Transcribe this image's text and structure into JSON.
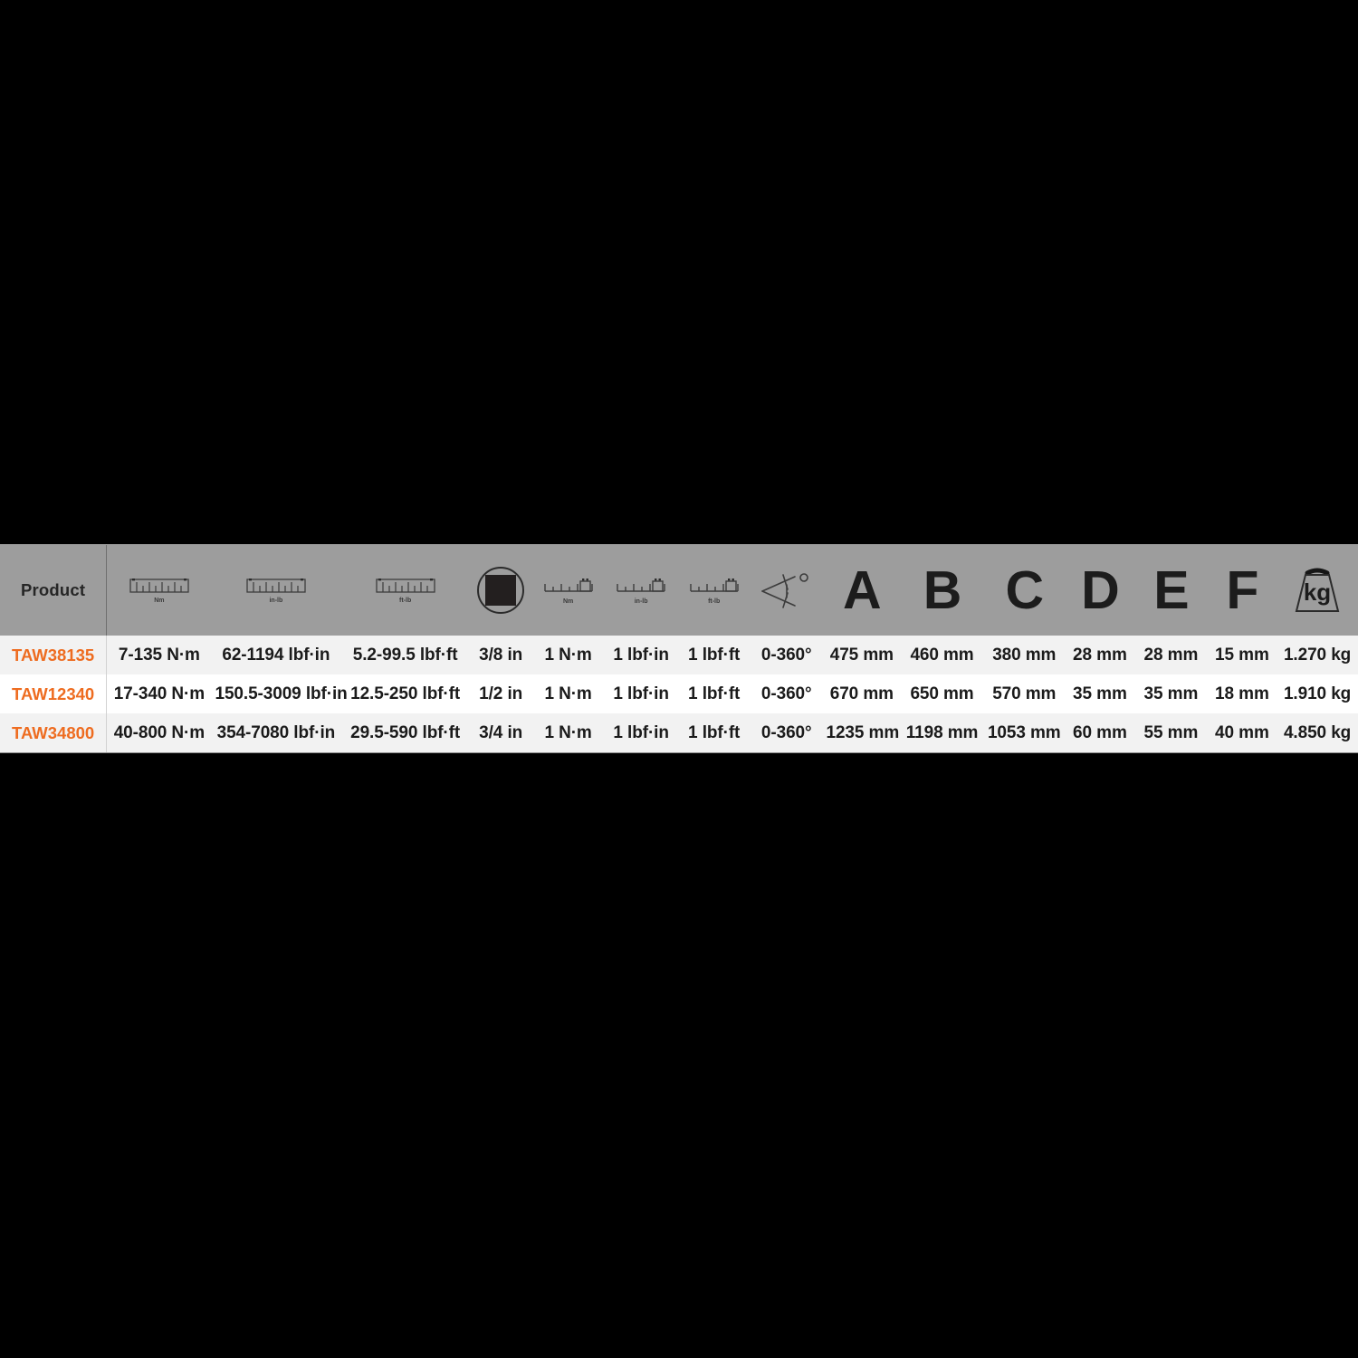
{
  "table": {
    "columns": [
      {
        "key": "product",
        "label": "Product",
        "icon": null,
        "icon_caption": null
      },
      {
        "key": "range_nm",
        "label": "",
        "icon": "ruler-icon",
        "icon_caption": "Nm"
      },
      {
        "key": "range_lbfin",
        "label": "",
        "icon": "ruler-icon",
        "icon_caption": "in-lb"
      },
      {
        "key": "range_lbfft",
        "label": "",
        "icon": "ruler-icon",
        "icon_caption": "ft-lb"
      },
      {
        "key": "drive",
        "label": "",
        "icon": "square-drive-icon",
        "icon_caption": null
      },
      {
        "key": "res_nm",
        "label": "",
        "icon": "graduation-icon",
        "icon_caption": "Nm"
      },
      {
        "key": "res_lbfin",
        "label": "",
        "icon": "graduation-icon",
        "icon_caption": "in-lb"
      },
      {
        "key": "res_lbfft",
        "label": "",
        "icon": "graduation-icon",
        "icon_caption": "ft-lb"
      },
      {
        "key": "angle",
        "label": "",
        "icon": "angle-degree-icon",
        "icon_caption": null
      },
      {
        "key": "dim_a",
        "label": "A",
        "icon": null,
        "icon_caption": null
      },
      {
        "key": "dim_b",
        "label": "B",
        "icon": null,
        "icon_caption": null
      },
      {
        "key": "dim_c",
        "label": "C",
        "icon": null,
        "icon_caption": null
      },
      {
        "key": "dim_d",
        "label": "D",
        "icon": null,
        "icon_caption": null
      },
      {
        "key": "dim_e",
        "label": "E",
        "icon": null,
        "icon_caption": null
      },
      {
        "key": "dim_f",
        "label": "F",
        "icon": null,
        "icon_caption": null
      },
      {
        "key": "weight",
        "label": "",
        "icon": "weight-kg-icon",
        "icon_caption": "kg"
      }
    ],
    "header": {
      "product_label": "Product",
      "letter_a": "A",
      "letter_b": "B",
      "letter_c": "C",
      "letter_d": "D",
      "letter_e": "E",
      "letter_f": "F",
      "caption_nm": "Nm",
      "caption_inlb": "in-lb",
      "caption_ftlb": "ft-lb",
      "caption_res_nm": "Nm",
      "caption_res_inlb": "in-lb",
      "caption_res_ftlb": "ft-lb",
      "caption_kg": "kg"
    },
    "rows": [
      {
        "product": "TAW38135",
        "range_nm": "7-135 N·m",
        "range_lbfin": "62-1194 lbf·in",
        "range_lbfft": "5.2-99.5 lbf·ft",
        "drive": "3/8 in",
        "res_nm": "1 N·m",
        "res_lbfin": "1 lbf·in",
        "res_lbfft": "1 lbf·ft",
        "angle": "0-360°",
        "dim_a": "475 mm",
        "dim_b": "460 mm",
        "dim_c": "380 mm",
        "dim_d": "28 mm",
        "dim_e": "28 mm",
        "dim_f": "15 mm",
        "weight": "1.270 kg"
      },
      {
        "product": "TAW12340",
        "range_nm": "17-340 N·m",
        "range_lbfin": "150.5-3009 lbf·in",
        "range_lbfft": "12.5-250 lbf·ft",
        "drive": "1/2 in",
        "res_nm": "1 N·m",
        "res_lbfin": "1 lbf·in",
        "res_lbfft": "1 lbf·ft",
        "angle": "0-360°",
        "dim_a": "670 mm",
        "dim_b": "650 mm",
        "dim_c": "570 mm",
        "dim_d": "35 mm",
        "dim_e": "35 mm",
        "dim_f": "18 mm",
        "weight": "1.910 kg"
      },
      {
        "product": "TAW34800",
        "range_nm": "40-800 N·m",
        "range_lbfin": "354-7080 lbf·in",
        "range_lbfft": "29.5-590 lbf·ft",
        "drive": "3/4 in",
        "res_nm": "1 N·m",
        "res_lbfin": "1 lbf·in",
        "res_lbfft": "1 lbf·ft",
        "angle": "0-360°",
        "dim_a": "1235 mm",
        "dim_b": "1198 mm",
        "dim_c": "1053 mm",
        "dim_d": "60 mm",
        "dim_e": "55 mm",
        "dim_f": "40 mm",
        "weight": "4.850 kg"
      }
    ]
  },
  "colors": {
    "accent_orange": "#ee6c20",
    "header_gray": "#9d9d9d",
    "row_light": "#f2f2f2",
    "row_white": "#ffffff",
    "text_dark": "#1b1b1b",
    "page_background": "#000000"
  }
}
